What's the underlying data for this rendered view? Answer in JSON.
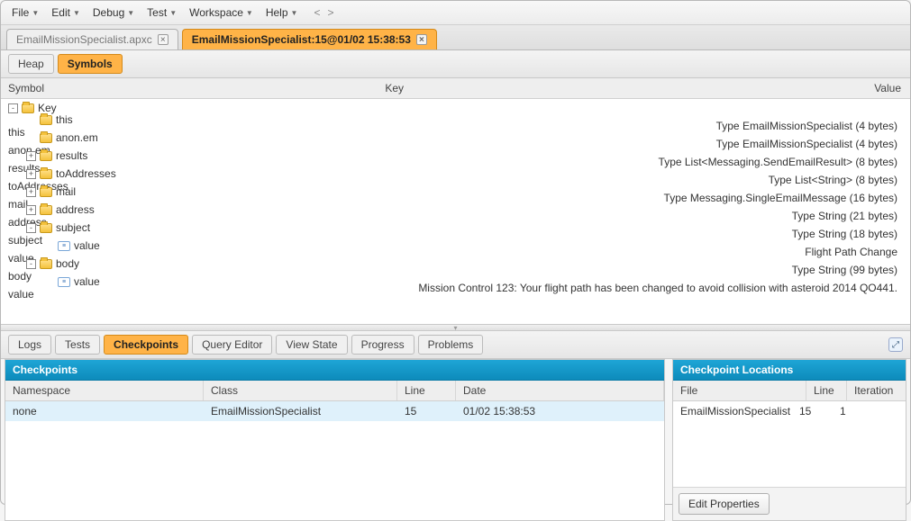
{
  "menu": {
    "items": [
      "File",
      "Edit",
      "Debug",
      "Test",
      "Workspace",
      "Help"
    ]
  },
  "fileTabs": [
    {
      "label": "EmailMissionSpecialist.apxc",
      "active": false
    },
    {
      "label": "EmailMissionSpecialist:15@01/02 15:38:53",
      "active": true
    }
  ],
  "subTabs": {
    "heap": "Heap",
    "symbols": "Symbols"
  },
  "columns": {
    "symbol": "Symbol",
    "key": "Key",
    "value": "Value"
  },
  "tree": [
    {
      "lv": 0,
      "tw": "-",
      "icon": "folder",
      "sym": "Key",
      "key": "",
      "val": ""
    },
    {
      "lv": 1,
      "tw": "",
      "icon": "folder",
      "sym": "this",
      "key": "this",
      "val": "Type EmailMissionSpecialist (4 bytes)"
    },
    {
      "lv": 1,
      "tw": "",
      "icon": "folder",
      "sym": "anon.em",
      "key": "anon.em",
      "val": "Type EmailMissionSpecialist (4 bytes)"
    },
    {
      "lv": 1,
      "tw": "+",
      "icon": "folder",
      "sym": "results",
      "key": "results",
      "val": "Type List<Messaging.SendEmailResult> (8 bytes)"
    },
    {
      "lv": 1,
      "tw": "+",
      "icon": "folder",
      "sym": "toAddresses",
      "key": "toAddresses",
      "val": "Type List<String> (8 bytes)"
    },
    {
      "lv": 1,
      "tw": "+",
      "icon": "folder",
      "sym": "mail",
      "key": "mail",
      "val": "Type Messaging.SingleEmailMessage (16 bytes)"
    },
    {
      "lv": 1,
      "tw": "+",
      "icon": "folder",
      "sym": "address",
      "key": "address",
      "val": "Type String (21 bytes)"
    },
    {
      "lv": 1,
      "tw": "-",
      "icon": "folder",
      "sym": "subject",
      "key": "subject",
      "val": "Type String (18 bytes)"
    },
    {
      "lv": 2,
      "tw": "",
      "icon": "value",
      "sym": "value",
      "key": "value",
      "val": "Flight Path Change"
    },
    {
      "lv": 1,
      "tw": "-",
      "icon": "folder",
      "sym": "body",
      "key": "body",
      "val": "Type String (99 bytes)"
    },
    {
      "lv": 2,
      "tw": "",
      "icon": "value",
      "sym": "value",
      "key": "value",
      "val": "Mission Control 123: Your flight path has been changed to avoid collision with asteroid 2014 QO441."
    }
  ],
  "bottomTabs": [
    "Logs",
    "Tests",
    "Checkpoints",
    "Query Editor",
    "View State",
    "Progress",
    "Problems"
  ],
  "bottomActive": "Checkpoints",
  "checkpointsPanel": {
    "title": "Checkpoints",
    "cols": {
      "ns": "Namespace",
      "cls": "Class",
      "line": "Line",
      "date": "Date"
    },
    "row": {
      "ns": "none",
      "cls": "EmailMissionSpecialist",
      "line": "15",
      "date": "01/02 15:38:53"
    }
  },
  "locationsPanel": {
    "title": "Checkpoint Locations",
    "cols": {
      "file": "File",
      "line": "Line",
      "iter": "Iteration"
    },
    "row": {
      "file": "EmailMissionSpecialist",
      "line": "15",
      "iter": "1"
    },
    "editBtn": "Edit Properties"
  }
}
